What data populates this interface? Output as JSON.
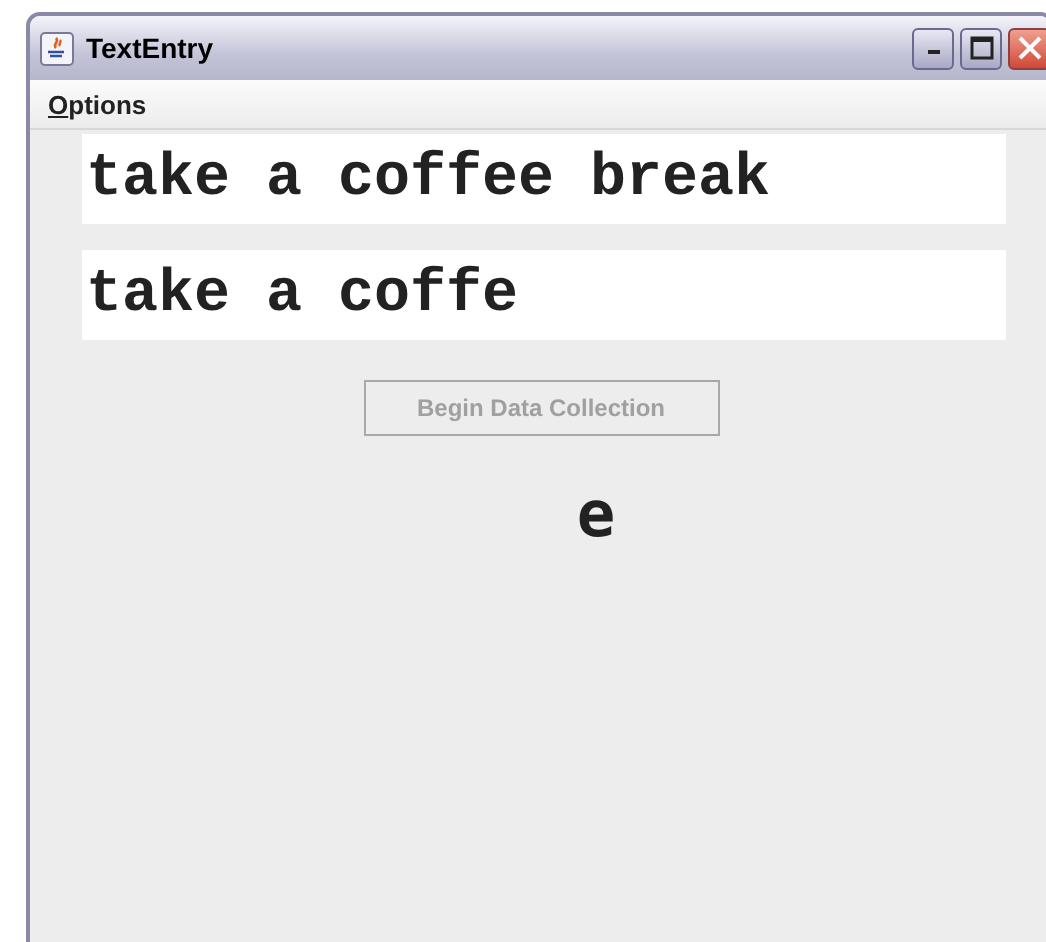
{
  "window": {
    "title": "TextEntry"
  },
  "menu": [
    {
      "label": "Options"
    }
  ],
  "fields": [
    {
      "value": "take a coffee break"
    },
    {
      "value": "take a coffe"
    }
  ],
  "button": {
    "label": "Begin Data Collection",
    "disabled": true
  },
  "current_letter": "e"
}
